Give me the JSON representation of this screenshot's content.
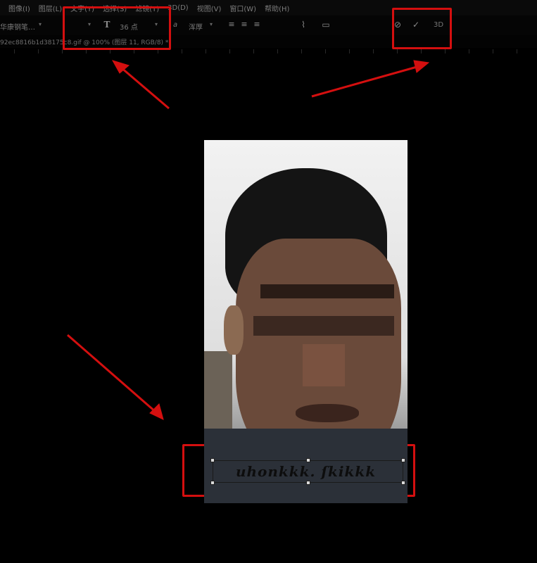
{
  "menubar": {
    "items": [
      "图像(I)",
      "图层(L)",
      "文字(Y)",
      "选择(S)",
      "滤镜(T)",
      "3D(D)",
      "视图(V)",
      "窗口(W)",
      "帮助(H)"
    ]
  },
  "options": {
    "font_family": "华康钢笔…",
    "font_size": "36 点",
    "aa_symbol": "a",
    "aa_mode": "浑厚"
  },
  "commit": {
    "three_d_label": "3D"
  },
  "document": {
    "tab_title": "92ec8816b1d38175c8.gif @ 100% (图层 11, RGB/8) *"
  },
  "canvas": {
    "caption": "uhonkkk. ſkikkk"
  },
  "colors": {
    "annotation": "#d40f0f",
    "background": "#000000"
  }
}
